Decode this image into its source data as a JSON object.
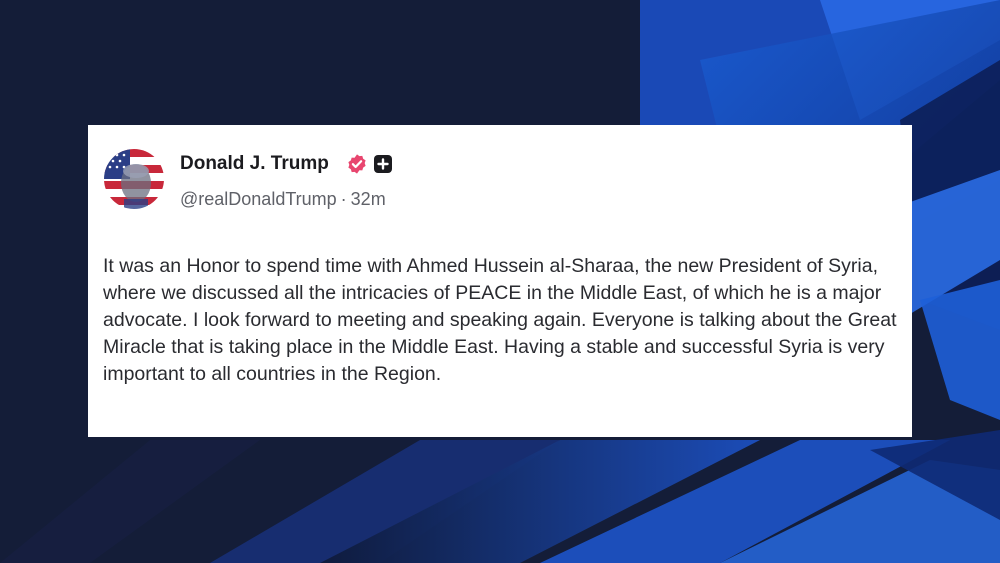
{
  "post": {
    "author_name": "Donald J. Trump",
    "handle": "@realDonaldTrump",
    "separator": "·",
    "time_ago": "32m",
    "body": "It was an Honor to spend time with Ahmed Hussein al-Sharaa, the new President of Syria, where we discussed all the intricacies of PEACE in the Middle East, of which he is a major advocate. I look forward to meeting and speaking again. Everyone is talking about the Great Miracle that is taking place in the Middle East. Having a stable and successful Syria is very important to all countries in the Region."
  },
  "icons": {
    "verified": "verified-badge-icon",
    "plus": "plus-square-icon",
    "avatar": "flag-portrait-avatar"
  },
  "colors": {
    "background": "#141d38",
    "accent_blue": "#1e5fd8",
    "verified_badge": "#e8466f",
    "card": "#ffffff",
    "text": "#2a2b30",
    "muted": "#5f6168"
  }
}
